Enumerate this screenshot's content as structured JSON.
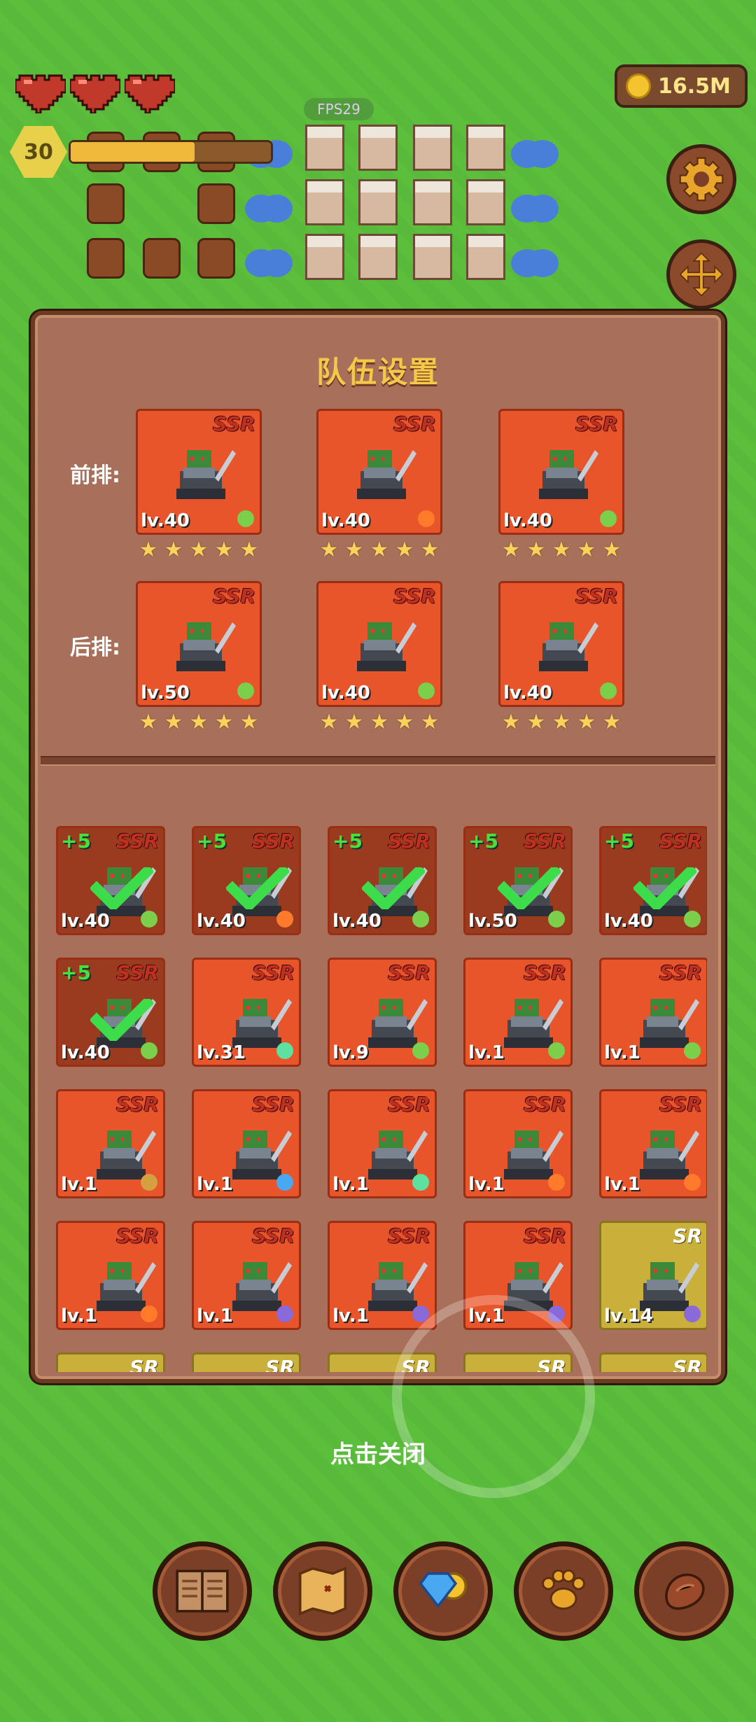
{
  "hud": {
    "level": "30",
    "xp_fraction": 0.62,
    "coins": "16.5M",
    "fps": "FPS29",
    "hearts": 3
  },
  "panel": {
    "title": "队伍设置",
    "front_label": "前排:",
    "back_label": "后排:",
    "front_row": [
      {
        "rarity": "SSR",
        "level": "lv.40",
        "stars": 5,
        "element": "leaf"
      },
      {
        "rarity": "SSR",
        "level": "lv.40",
        "stars": 5,
        "element": "sun"
      },
      {
        "rarity": "SSR",
        "level": "lv.40",
        "stars": 5,
        "element": "leaf"
      }
    ],
    "back_row": [
      {
        "rarity": "SSR",
        "level": "lv.50",
        "stars": 5,
        "element": "leaf"
      },
      {
        "rarity": "SSR",
        "level": "lv.40",
        "stars": 5,
        "element": "leaf"
      },
      {
        "rarity": "SSR",
        "level": "lv.40",
        "stars": 5,
        "element": "leaf"
      }
    ],
    "roster": [
      {
        "plus": "+5",
        "rarity": "SSR",
        "level": "lv.40",
        "selected": true,
        "element": "leaf"
      },
      {
        "plus": "+5",
        "rarity": "SSR",
        "level": "lv.40",
        "selected": true,
        "element": "sun"
      },
      {
        "plus": "+5",
        "rarity": "SSR",
        "level": "lv.40",
        "selected": true,
        "element": "leaf"
      },
      {
        "plus": "+5",
        "rarity": "SSR",
        "level": "lv.50",
        "selected": true,
        "element": "leaf"
      },
      {
        "plus": "+5",
        "rarity": "SSR",
        "level": "lv.40",
        "selected": true,
        "element": "leaf"
      },
      {
        "plus": "+5",
        "rarity": "SSR",
        "level": "lv.40",
        "selected": true,
        "element": "leaf"
      },
      {
        "plus": "",
        "rarity": "SSR",
        "level": "lv.31",
        "selected": false,
        "element": "gem"
      },
      {
        "plus": "",
        "rarity": "SSR",
        "level": "lv.9",
        "selected": false,
        "element": "leaf"
      },
      {
        "plus": "",
        "rarity": "SSR",
        "level": "lv.1",
        "selected": false,
        "element": "leaf"
      },
      {
        "plus": "",
        "rarity": "SSR",
        "level": "lv.1",
        "selected": false,
        "element": "leaf"
      },
      {
        "plus": "",
        "rarity": "SSR",
        "level": "lv.1",
        "selected": false,
        "element": "rock"
      },
      {
        "plus": "",
        "rarity": "SSR",
        "level": "lv.1",
        "selected": false,
        "element": "water"
      },
      {
        "plus": "",
        "rarity": "SSR",
        "level": "lv.1",
        "selected": false,
        "element": "gem"
      },
      {
        "plus": "",
        "rarity": "SSR",
        "level": "lv.1",
        "selected": false,
        "element": "sun"
      },
      {
        "plus": "",
        "rarity": "SSR",
        "level": "lv.1",
        "selected": false,
        "element": "sun"
      },
      {
        "plus": "",
        "rarity": "SSR",
        "level": "lv.1",
        "selected": false,
        "element": "sun"
      },
      {
        "plus": "",
        "rarity": "SSR",
        "level": "lv.1",
        "selected": false,
        "element": "moon"
      },
      {
        "plus": "",
        "rarity": "SSR",
        "level": "lv.1",
        "selected": false,
        "element": "moon"
      },
      {
        "plus": "",
        "rarity": "SSR",
        "level": "lv.1",
        "selected": false,
        "element": "moon"
      },
      {
        "plus": "",
        "rarity": "SR",
        "level": "lv.14",
        "selected": false,
        "element": "moon"
      },
      {
        "plus": "",
        "rarity": "SR",
        "level": "",
        "selected": false,
        "element": ""
      },
      {
        "plus": "",
        "rarity": "SR",
        "level": "",
        "selected": false,
        "element": ""
      },
      {
        "plus": "",
        "rarity": "SR",
        "level": "",
        "selected": false,
        "element": ""
      },
      {
        "plus": "",
        "rarity": "SR",
        "level": "",
        "selected": false,
        "element": ""
      },
      {
        "plus": "",
        "rarity": "SR",
        "level": "",
        "selected": false,
        "element": ""
      }
    ]
  },
  "close_hint": "点击关闭",
  "bottom_bar": [
    {
      "name": "codex",
      "icon": "book-icon"
    },
    {
      "name": "map",
      "icon": "map-scroll-icon"
    },
    {
      "name": "shop",
      "icon": "diamond-coin-icon"
    },
    {
      "name": "pets",
      "icon": "paw-icon"
    },
    {
      "name": "food",
      "icon": "meat-icon"
    }
  ],
  "colors": {
    "ssr_card": "#e8552a",
    "sr_card": "#c9b03a",
    "panel": "#a8705a",
    "title": "#f5c84a"
  }
}
